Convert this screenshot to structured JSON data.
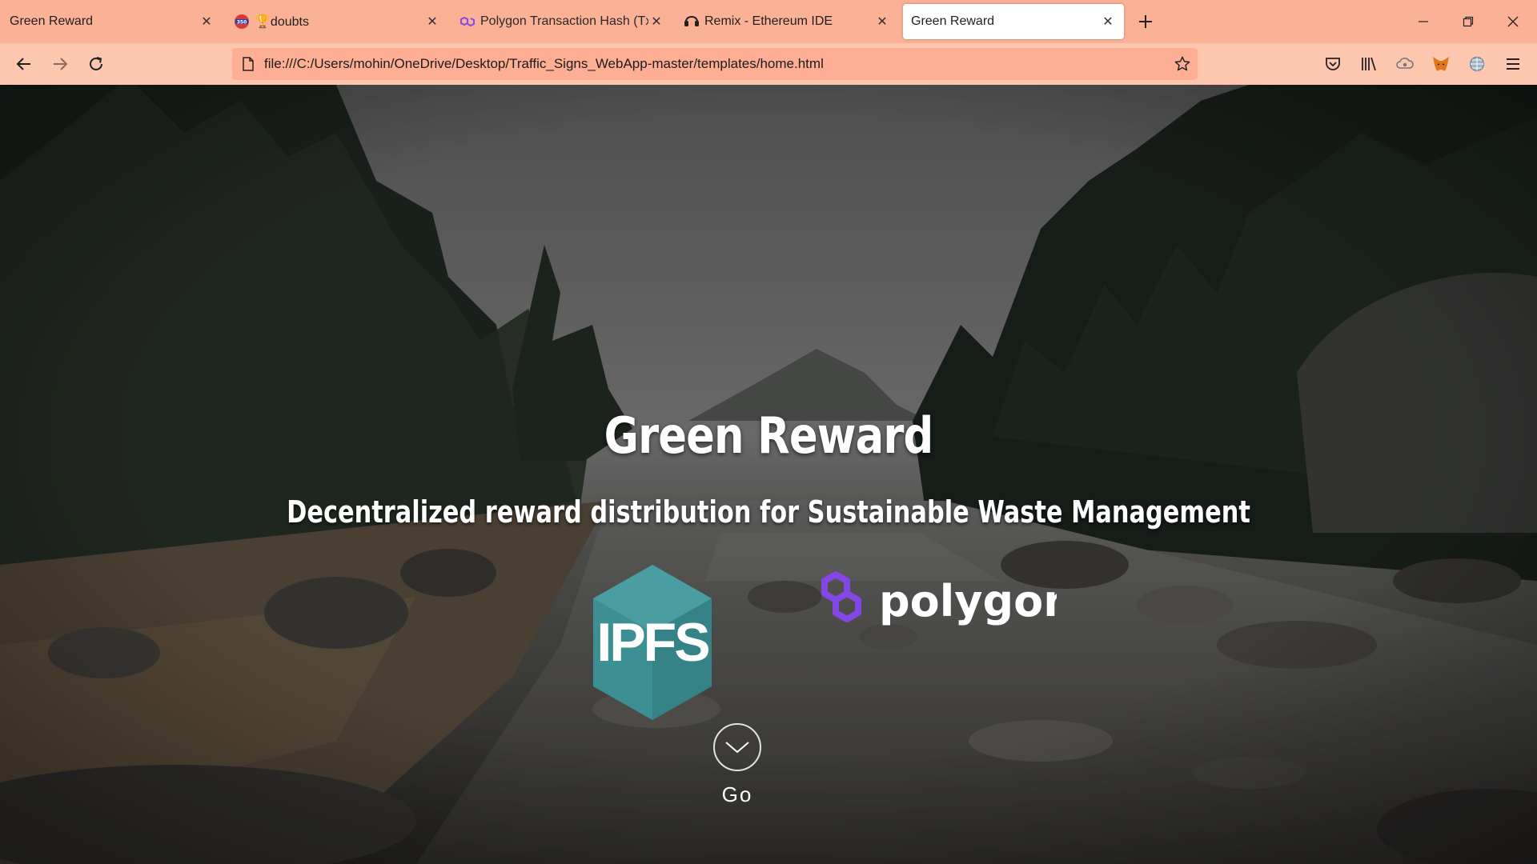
{
  "browser": {
    "tabs": [
      {
        "title": "Green Reward",
        "favicon": "none",
        "active": false
      },
      {
        "title": "🏆doubts",
        "favicon": "badge-350-icon",
        "active": false
      },
      {
        "title": "Polygon Transaction Hash (Txha",
        "favicon": "polygon-icon",
        "active": false
      },
      {
        "title": "Remix - Ethereum IDE",
        "favicon": "remix-icon",
        "active": false
      },
      {
        "title": "Green Reward",
        "favicon": "none",
        "active": true
      }
    ],
    "tab_close_glyph": "✕",
    "url": "file:///C:/Users/mohin/OneDrive/Desktop/Traffic_Signs_WebApp-master/templates/home.html",
    "colors": {
      "tab_strip": "#fbb195",
      "toolbar": "#fcc7ae",
      "url_field": "#fdae94"
    }
  },
  "hero": {
    "title": "Green Reward",
    "subtitle": "Decentralized reward distribution for Sustainable Waste Management",
    "ipfs_logo_text": "IPFS",
    "polygon_logo_text": "polygon",
    "go_label": "Go",
    "colors": {
      "ipfs": "#3c8f92",
      "polygon": "#8247e5"
    }
  }
}
